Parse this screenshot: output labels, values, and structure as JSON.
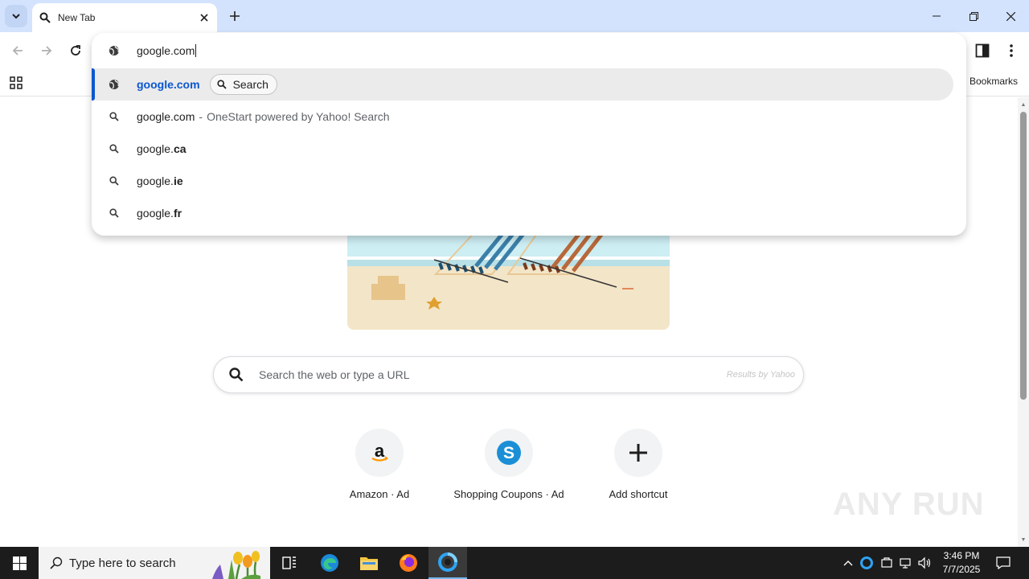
{
  "browser": {
    "tab": {
      "title": "New Tab"
    },
    "toolbar": {
      "all_bookmarks_label": "All Bookmarks"
    }
  },
  "omnibox": {
    "input_text": "google.com",
    "suggestions": [
      {
        "type": "navigation",
        "icon": "globe-icon",
        "text": "google.com",
        "chip_label": "Search",
        "selected": true
      },
      {
        "type": "search",
        "icon": "search-icon",
        "text": "google.com",
        "separator": "-",
        "description": "OneStart powered by Yahoo! Search"
      },
      {
        "type": "search",
        "icon": "search-icon",
        "prefix": "google.",
        "suffix": "ca"
      },
      {
        "type": "search",
        "icon": "search-icon",
        "prefix": "google.",
        "suffix": "ie"
      },
      {
        "type": "search",
        "icon": "search-icon",
        "prefix": "google.",
        "suffix": "fr"
      }
    ]
  },
  "ntp": {
    "search_placeholder": "Search the web or type a URL",
    "results_by": "Results by Yahoo",
    "shortcuts": [
      {
        "label": "Amazon · Ad",
        "icon": "amazon-icon"
      },
      {
        "label": "Shopping Coupons · Ad",
        "icon": "coupons-icon"
      },
      {
        "label": "Add shortcut",
        "icon": "plus-icon"
      }
    ],
    "watermark": "ANY RUN"
  },
  "taskbar": {
    "search_text": "Type here to search",
    "time": "3:46 PM",
    "date": "7/7/2025"
  },
  "colors": {
    "accent": "#0b57d0",
    "tabstrip": "#d3e3fd",
    "taskbar": "#1c1c1c"
  }
}
